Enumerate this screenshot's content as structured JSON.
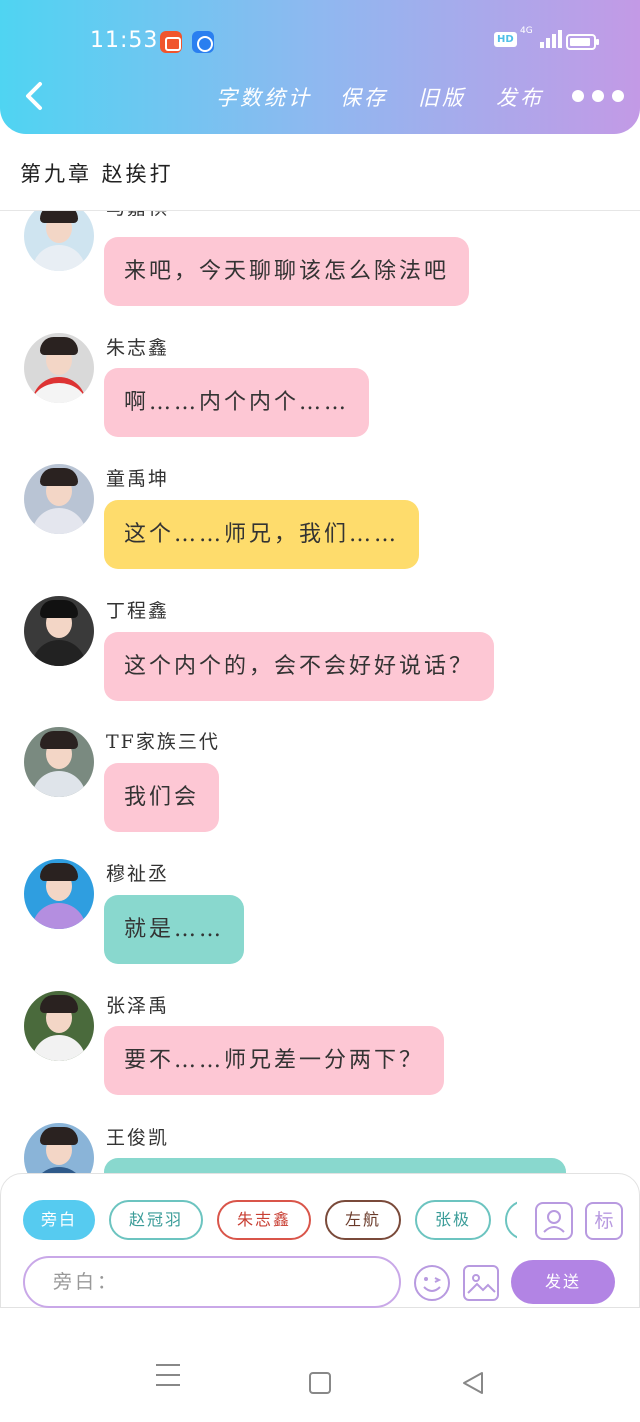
{
  "status_bar": {
    "time": "11:53",
    "hd_badge": "HD",
    "network": "4G"
  },
  "nav": {
    "back_icon": "chevron-left-icon",
    "word_count": "字数统计",
    "save": "保存",
    "old_version": "旧版",
    "publish": "发布",
    "more_icon": "more-dots-icon"
  },
  "chapter_title": "第九章 赵挨打",
  "colors": {
    "pink_bubble": "#fdc7d4",
    "yellow_bubble": "#fedc6c",
    "teal_bubble": "#89d8ce",
    "accent_purple": "#b284e4",
    "accent_blue": "#56cbf0"
  },
  "messages": [
    {
      "sender": "马嘉祺",
      "text": "来吧，今天聊聊该怎么除法吧",
      "color": "#fdc7d4"
    },
    {
      "sender": "朱志鑫",
      "text": "啊……内个内个……",
      "color": "#fdc7d4"
    },
    {
      "sender": "童禹坤",
      "text": "这个……师兄，我们……",
      "color": "#fedc6c"
    },
    {
      "sender": "丁程鑫",
      "text": "这个内个的，会不会好好说话？",
      "color": "#fdc7d4"
    },
    {
      "sender": "TF家族三代",
      "text": "我们会",
      "color": "#fdc7d4"
    },
    {
      "sender": "穆祉丞",
      "text": "就是……",
      "color": "#89d8ce"
    },
    {
      "sender": "张泽禹",
      "text": "要不……师兄差一分两下？",
      "color": "#fdc7d4"
    },
    {
      "sender": "王俊凯",
      "text": "",
      "color": "#89d8ce"
    }
  ],
  "composer": {
    "chips": [
      "旁白",
      "赵冠羽",
      "朱志鑫",
      "左航",
      "张极"
    ],
    "mark_button": "标",
    "input_placeholder": "旁白：",
    "send": "发送"
  }
}
